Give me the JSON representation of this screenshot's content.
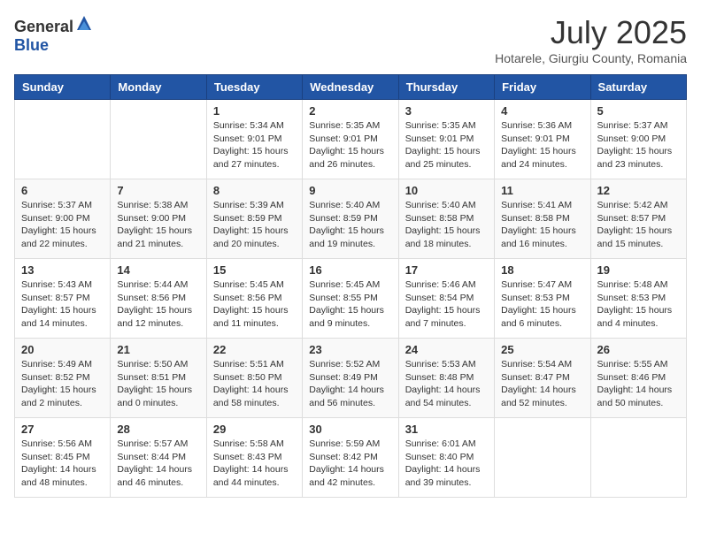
{
  "header": {
    "logo_general": "General",
    "logo_blue": "Blue",
    "month": "July 2025",
    "location": "Hotarele, Giurgiu County, Romania"
  },
  "weekdays": [
    "Sunday",
    "Monday",
    "Tuesday",
    "Wednesday",
    "Thursday",
    "Friday",
    "Saturday"
  ],
  "weeks": [
    [
      {
        "day": "",
        "info": ""
      },
      {
        "day": "",
        "info": ""
      },
      {
        "day": "1",
        "info": "Sunrise: 5:34 AM\nSunset: 9:01 PM\nDaylight: 15 hours and 27 minutes."
      },
      {
        "day": "2",
        "info": "Sunrise: 5:35 AM\nSunset: 9:01 PM\nDaylight: 15 hours and 26 minutes."
      },
      {
        "day": "3",
        "info": "Sunrise: 5:35 AM\nSunset: 9:01 PM\nDaylight: 15 hours and 25 minutes."
      },
      {
        "day": "4",
        "info": "Sunrise: 5:36 AM\nSunset: 9:01 PM\nDaylight: 15 hours and 24 minutes."
      },
      {
        "day": "5",
        "info": "Sunrise: 5:37 AM\nSunset: 9:00 PM\nDaylight: 15 hours and 23 minutes."
      }
    ],
    [
      {
        "day": "6",
        "info": "Sunrise: 5:37 AM\nSunset: 9:00 PM\nDaylight: 15 hours and 22 minutes."
      },
      {
        "day": "7",
        "info": "Sunrise: 5:38 AM\nSunset: 9:00 PM\nDaylight: 15 hours and 21 minutes."
      },
      {
        "day": "8",
        "info": "Sunrise: 5:39 AM\nSunset: 8:59 PM\nDaylight: 15 hours and 20 minutes."
      },
      {
        "day": "9",
        "info": "Sunrise: 5:40 AM\nSunset: 8:59 PM\nDaylight: 15 hours and 19 minutes."
      },
      {
        "day": "10",
        "info": "Sunrise: 5:40 AM\nSunset: 8:58 PM\nDaylight: 15 hours and 18 minutes."
      },
      {
        "day": "11",
        "info": "Sunrise: 5:41 AM\nSunset: 8:58 PM\nDaylight: 15 hours and 16 minutes."
      },
      {
        "day": "12",
        "info": "Sunrise: 5:42 AM\nSunset: 8:57 PM\nDaylight: 15 hours and 15 minutes."
      }
    ],
    [
      {
        "day": "13",
        "info": "Sunrise: 5:43 AM\nSunset: 8:57 PM\nDaylight: 15 hours and 14 minutes."
      },
      {
        "day": "14",
        "info": "Sunrise: 5:44 AM\nSunset: 8:56 PM\nDaylight: 15 hours and 12 minutes."
      },
      {
        "day": "15",
        "info": "Sunrise: 5:45 AM\nSunset: 8:56 PM\nDaylight: 15 hours and 11 minutes."
      },
      {
        "day": "16",
        "info": "Sunrise: 5:45 AM\nSunset: 8:55 PM\nDaylight: 15 hours and 9 minutes."
      },
      {
        "day": "17",
        "info": "Sunrise: 5:46 AM\nSunset: 8:54 PM\nDaylight: 15 hours and 7 minutes."
      },
      {
        "day": "18",
        "info": "Sunrise: 5:47 AM\nSunset: 8:53 PM\nDaylight: 15 hours and 6 minutes."
      },
      {
        "day": "19",
        "info": "Sunrise: 5:48 AM\nSunset: 8:53 PM\nDaylight: 15 hours and 4 minutes."
      }
    ],
    [
      {
        "day": "20",
        "info": "Sunrise: 5:49 AM\nSunset: 8:52 PM\nDaylight: 15 hours and 2 minutes."
      },
      {
        "day": "21",
        "info": "Sunrise: 5:50 AM\nSunset: 8:51 PM\nDaylight: 15 hours and 0 minutes."
      },
      {
        "day": "22",
        "info": "Sunrise: 5:51 AM\nSunset: 8:50 PM\nDaylight: 14 hours and 58 minutes."
      },
      {
        "day": "23",
        "info": "Sunrise: 5:52 AM\nSunset: 8:49 PM\nDaylight: 14 hours and 56 minutes."
      },
      {
        "day": "24",
        "info": "Sunrise: 5:53 AM\nSunset: 8:48 PM\nDaylight: 14 hours and 54 minutes."
      },
      {
        "day": "25",
        "info": "Sunrise: 5:54 AM\nSunset: 8:47 PM\nDaylight: 14 hours and 52 minutes."
      },
      {
        "day": "26",
        "info": "Sunrise: 5:55 AM\nSunset: 8:46 PM\nDaylight: 14 hours and 50 minutes."
      }
    ],
    [
      {
        "day": "27",
        "info": "Sunrise: 5:56 AM\nSunset: 8:45 PM\nDaylight: 14 hours and 48 minutes."
      },
      {
        "day": "28",
        "info": "Sunrise: 5:57 AM\nSunset: 8:44 PM\nDaylight: 14 hours and 46 minutes."
      },
      {
        "day": "29",
        "info": "Sunrise: 5:58 AM\nSunset: 8:43 PM\nDaylight: 14 hours and 44 minutes."
      },
      {
        "day": "30",
        "info": "Sunrise: 5:59 AM\nSunset: 8:42 PM\nDaylight: 14 hours and 42 minutes."
      },
      {
        "day": "31",
        "info": "Sunrise: 6:01 AM\nSunset: 8:40 PM\nDaylight: 14 hours and 39 minutes."
      },
      {
        "day": "",
        "info": ""
      },
      {
        "day": "",
        "info": ""
      }
    ]
  ]
}
